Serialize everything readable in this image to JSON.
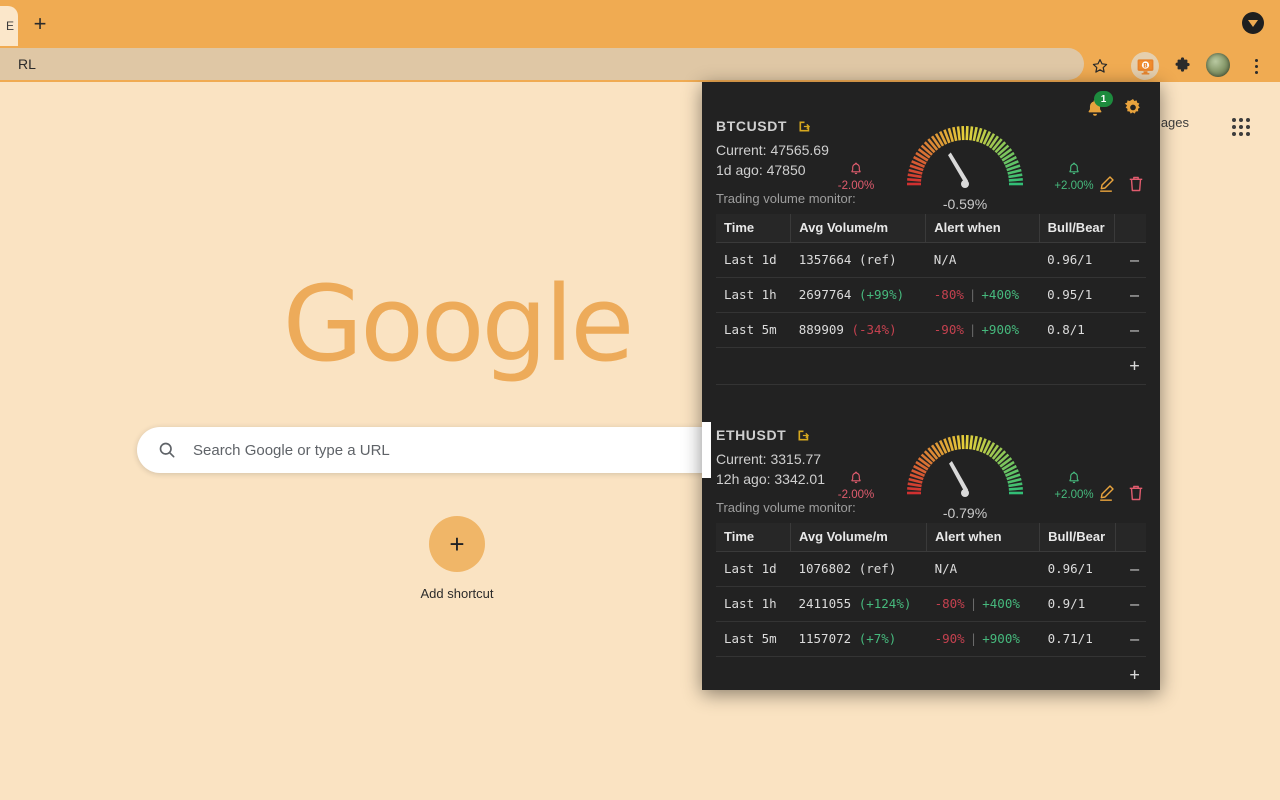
{
  "browser": {
    "tab_title_fragment": "E",
    "new_tab_label": "+",
    "tab_search_icon": "caret-down-icon",
    "omnibox_value": "RL",
    "omnibox_placeholder": "Search Google or type a URL",
    "bookmark_icon": "star-icon",
    "extension_icon": "bitcoin-monitor-icon",
    "extensions_icon": "puzzle-piece-icon",
    "profile_icon": "avatar",
    "menu_icon": "three-dot-menu-icon"
  },
  "ntp": {
    "images_link": "mages",
    "apps_grid_icon": "apps-grid-icon",
    "logo_text": "Google",
    "search_icon": "search-icon",
    "search_placeholder": "Search Google or type a URL",
    "search_value": "",
    "add_shortcut_plus": "+",
    "add_shortcut_label": "Add shortcut"
  },
  "popup": {
    "notification_icon": "bell-icon",
    "notification_badge": "1",
    "settings_icon": "gear-icon",
    "edit_icon": "pencil-icon",
    "delete_icon": "trash-icon",
    "symbol_link_icon": "external-link-icon",
    "monitor_label": "Trading volume monitor:",
    "columns": [
      "Time",
      "Avg Volume/m",
      "Alert when",
      "Bull/Bear",
      ""
    ],
    "remove_glyph": "—",
    "add_glyph": "+",
    "colors": {
      "panel_bg": "#222222",
      "accent_orange": "#e8a33d",
      "up_green": "#46b97d",
      "down_red": "#c4414f",
      "badge_green": "#1d8b3e"
    },
    "cards": [
      {
        "symbol": "BTCUSDT",
        "current_label": "Current: 47565.69",
        "ago_label": "1d ago: 47850",
        "gauge": {
          "low_threshold": "-2.00%",
          "high_threshold": "+2.00%",
          "value": "-0.59%",
          "value_number": -0.59,
          "low_number": -2.0,
          "high_number": 2.0
        },
        "rows": [
          {
            "time": "Last 1d",
            "volume": "1357664",
            "change": "(ref)",
            "change_dir": "none",
            "alert_low": "N/A",
            "alert_high": "",
            "ratio": "0.96/1"
          },
          {
            "time": "Last 1h",
            "volume": "2697764",
            "change": "(+99%)",
            "change_dir": "up",
            "alert_low": "-80%",
            "alert_high": "+400%",
            "ratio": "0.95/1"
          },
          {
            "time": "Last 5m",
            "volume": "889909",
            "change": "(-34%)",
            "change_dir": "down",
            "alert_low": "-90%",
            "alert_high": "+900%",
            "ratio": "0.8/1"
          }
        ]
      },
      {
        "symbol": "ETHUSDT",
        "current_label": "Current: 3315.77",
        "ago_label": "12h ago: 3342.01",
        "gauge": {
          "low_threshold": "-2.00%",
          "high_threshold": "+2.00%",
          "value": "-0.79%",
          "value_number": -0.79,
          "low_number": -2.0,
          "high_number": 2.0
        },
        "rows": [
          {
            "time": "Last 1d",
            "volume": "1076802",
            "change": "(ref)",
            "change_dir": "none",
            "alert_low": "N/A",
            "alert_high": "",
            "ratio": "0.96/1"
          },
          {
            "time": "Last 1h",
            "volume": "2411055",
            "change": "(+124%)",
            "change_dir": "up",
            "alert_low": "-80%",
            "alert_high": "+400%",
            "ratio": "0.9/1"
          },
          {
            "time": "Last 5m",
            "volume": "1157072",
            "change": "(+7%)",
            "change_dir": "up",
            "alert_low": "-90%",
            "alert_high": "+900%",
            "ratio": "0.71/1"
          }
        ]
      }
    ]
  }
}
